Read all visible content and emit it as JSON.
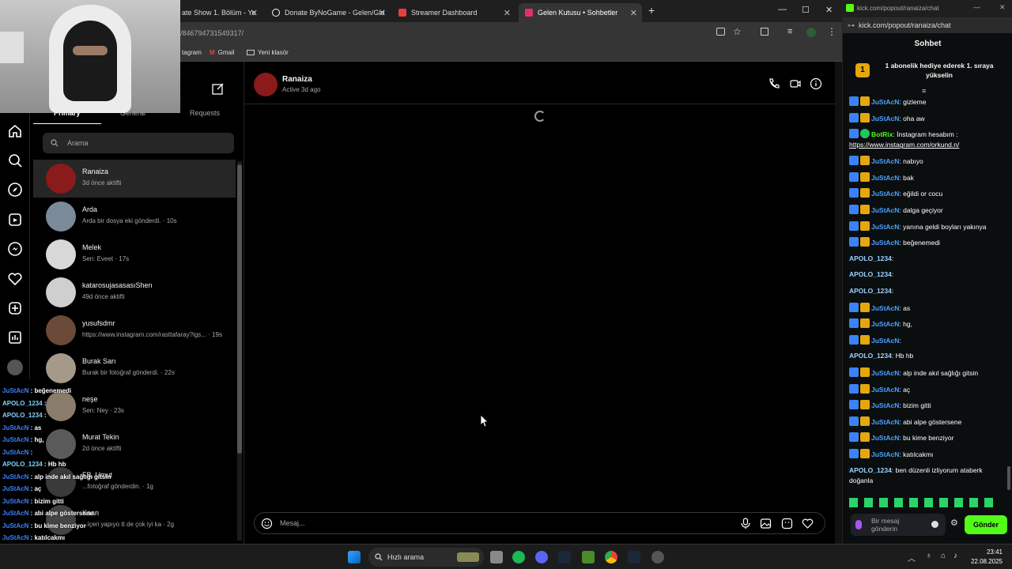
{
  "browser": {
    "tabs": [
      {
        "label": "ate Show 1. Bölüm - Yo",
        "color": "#ff0000"
      },
      {
        "label": "Donate ByNoGame - Gelen/Gid",
        "color": "#ffffff"
      },
      {
        "label": "Streamer Dashboard",
        "color": "#e53e3e"
      },
      {
        "label": "Gelen Kutusu • Sohbetler",
        "color": "#e1306c"
      }
    ],
    "url": "/846794731549317/",
    "bookmarks": [
      "tagram",
      "Gmail",
      "Yeni klasör"
    ]
  },
  "instagram": {
    "tabs": [
      "Primary",
      "General",
      "Requests"
    ],
    "search_placeholder": "Arama",
    "conversations": [
      {
        "name": "Ranaiza",
        "sub": "3d önce aktifti",
        "color": "#8b1a1a"
      },
      {
        "name": "Arda",
        "sub": "Arda bir dosya eki gönderdi. · 10s",
        "color": "#7a8a99"
      },
      {
        "name": "Melek",
        "sub": "Sen: Eveet · 17s",
        "color": "#d8d8d8"
      },
      {
        "name": "katarosujasasasıShen",
        "sub": "49d önce aktifti",
        "color": "#cfcfcf"
      },
      {
        "name": "yusufsdmr",
        "sub": "https://www.instagram.com/rasttafaray?igs... · 19s",
        "color": "#6b4a3a"
      },
      {
        "name": "Burak Sarı",
        "sub": "Burak bir fotoğraf gönderdi. · 22s",
        "color": "#a59a8a"
      },
      {
        "name": "neşe",
        "sub": "Sen: Ney · 23s",
        "color": "#8a7c6a"
      },
      {
        "name": "Murat Tekin",
        "sub": "2d önce aktifti",
        "color": "#5a5a5a"
      },
      {
        "name": "FB. Umut",
        "sub": "...fotoğraf gönderdin. · 1g",
        "color": "#3a3a3a"
      },
      {
        "name": "Kaan",
        "sub": "...içeri yapıyo tt de çok iyi ka · 2g",
        "color": "#444"
      }
    ],
    "chat_header": {
      "name": "Ranaiza",
      "status": "Active 3d ago"
    },
    "message_placeholder": "Mesaj..."
  },
  "overlay_chat": [
    {
      "user": "JuStAcN",
      "text": " : beğenemedi"
    },
    {
      "user": "APOLO_1234",
      "text": " :"
    },
    {
      "user": "APOLO_1234",
      "text": " :"
    },
    {
      "user": "JuStAcN",
      "text": " : as"
    },
    {
      "user": "JuStAcN",
      "text": " : hg,"
    },
    {
      "user": "JuStAcN",
      "text": " :"
    },
    {
      "user": "APOLO_1234",
      "text": " : Hb hb"
    },
    {
      "user": "JuStAcN",
      "text": " : alp inde akıl sağlığı gitsin"
    },
    {
      "user": "JuStAcN",
      "text": " : aç"
    },
    {
      "user": "JuStAcN",
      "text": " : bizim gitti"
    },
    {
      "user": "JuStAcN",
      "text": " : abi alpe göstersene"
    },
    {
      "user": "JuStAcN",
      "text": " : bu kime benziyor"
    },
    {
      "user": "JuStAcN",
      "text": " : katılcakmı"
    },
    {
      "user": "APOLO_1234",
      "text": " : ben düzenli izliyorum ataberk doğanla"
    }
  ],
  "kick": {
    "url": "kick.com/popout/ranaiza/chat",
    "title": "Sohbet",
    "promo": "1 abonelik hediye ederek 1. sıraya yükselin",
    "promo_rank": "1",
    "messages": [
      {
        "user": "JuStAcN",
        "text": ": gizleme",
        "badges": true
      },
      {
        "user": "JuStAcN",
        "text": ": oha aw",
        "badges": true
      },
      {
        "user": "BotRix",
        "text": ": İnstagram hesabım :",
        "bot": true,
        "link": "https://www.instagram.com/orkund.n/"
      },
      {
        "user": "JuStAcN",
        "text": ": nabıyo",
        "badges": true
      },
      {
        "user": "JuStAcN",
        "text": ": bak",
        "badges": true
      },
      {
        "user": "JuStAcN",
        "text": ": eğildi or cocu",
        "badges": true
      },
      {
        "user": "JuStAcN",
        "text": ": dalga geçiyor",
        "badges": true
      },
      {
        "user": "JuStAcN",
        "text": ": yanına geldi boyları yakınya",
        "badges": true
      },
      {
        "user": "JuStAcN",
        "text": ": beğenemedi",
        "badges": true
      },
      {
        "user": "APOLO_1234",
        "text": ":",
        "badges": false
      },
      {
        "user": "APOLO_1234",
        "text": ":",
        "badges": false
      },
      {
        "user": "APOLO_1234",
        "text": ":",
        "badges": false
      },
      {
        "user": "JuStAcN",
        "text": ": as",
        "badges": true
      },
      {
        "user": "JuStAcN",
        "text": ": hg,",
        "badges": true
      },
      {
        "user": "JuStAcN",
        "text": ":",
        "badges": true
      },
      {
        "user": "APOLO_1234",
        "text": ": Hb hb",
        "badges": false
      },
      {
        "user": "JuStAcN",
        "text": ": alp inde akıl sağlığı gitsin",
        "badges": true
      },
      {
        "user": "JuStAcN",
        "text": ": aç",
        "badges": true
      },
      {
        "user": "JuStAcN",
        "text": ": bizim gitti",
        "badges": true
      },
      {
        "user": "JuStAcN",
        "text": ": abi alpe göstersene",
        "badges": true
      },
      {
        "user": "JuStAcN",
        "text": ": bu kime benziyor",
        "badges": true
      },
      {
        "user": "JuStAcN",
        "text": ": katılcakmı",
        "badges": true
      },
      {
        "user": "APOLO_1234",
        "text": ": ben düzenli izliyorum ataberk doğanla",
        "badges": false
      }
    ],
    "input_placeholder": "Bir mesaj gönderin",
    "send_label": "Gönder"
  },
  "taskbar": {
    "search_placeholder": "Hızlı arama",
    "time": "23:41",
    "date": "22.08.2025"
  }
}
